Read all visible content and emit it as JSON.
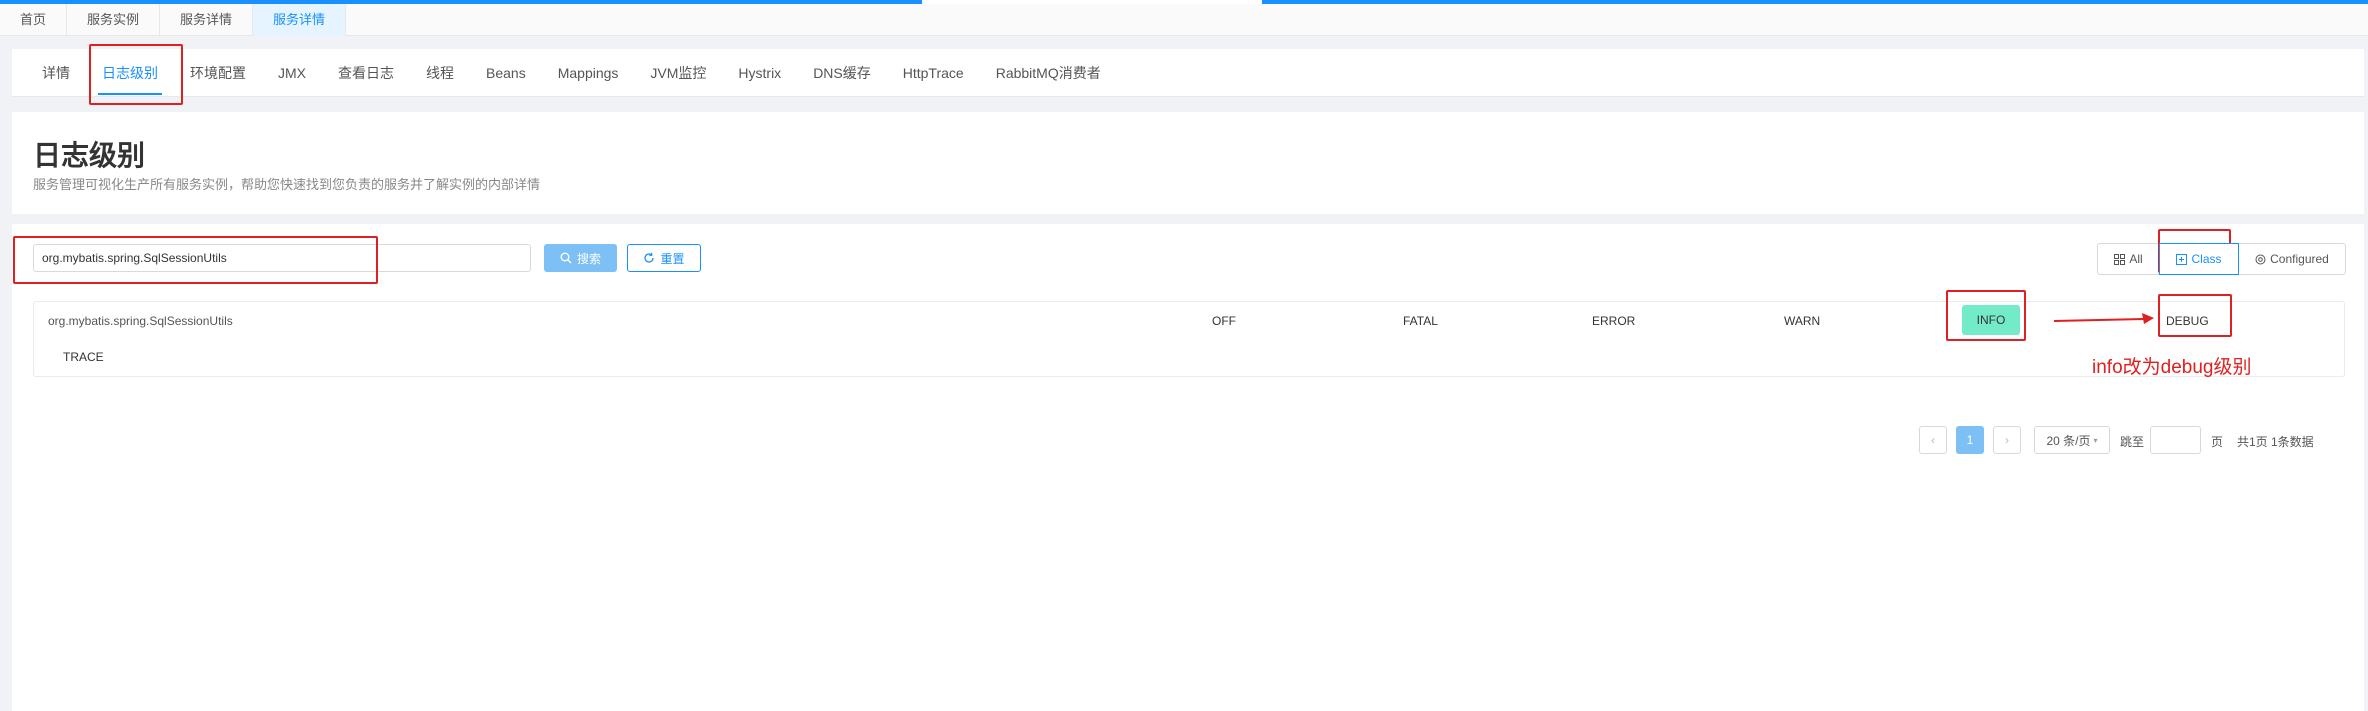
{
  "crumb_tabs": [
    "首页",
    "服务实例",
    "服务详情",
    "服务详情"
  ],
  "nav_tabs": [
    "详情",
    "日志级别",
    "环境配置",
    "JMX",
    "查看日志",
    "线程",
    "Beans",
    "Mappings",
    "JVM监控",
    "Hystrix",
    "DNS缓存",
    "HttpTrace",
    "RabbitMQ消费者"
  ],
  "page": {
    "title": "日志级别",
    "description": "服务管理可视化生产所有服务实例，帮助您快速找到您负责的服务并了解实例的内部详情"
  },
  "search": {
    "value": "org.mybatis.spring.SqlSessionUtils",
    "search_label": "搜索",
    "reset_label": "重置"
  },
  "filters": {
    "all": "All",
    "class": "Class",
    "configured": "Configured"
  },
  "logger": {
    "name": "org.mybatis.spring.SqlSessionUtils",
    "levels": {
      "off": "OFF",
      "fatal": "FATAL",
      "error": "ERROR",
      "warn": "WARN",
      "info": "INFO",
      "debug": "DEBUG",
      "trace": "TRACE"
    },
    "active_level": "INFO"
  },
  "pagination": {
    "prev": "‹",
    "current_page": "1",
    "next": "›",
    "page_size": "20 条/页",
    "jump_label": "跳至",
    "jump_suffix": "页",
    "total": "共1页 1条数据"
  },
  "annotation": {
    "text": "info改为debug级别"
  },
  "colors": {
    "accent": "#1890ff",
    "info_active": "#74ebc8",
    "annotation": "#e02020"
  }
}
